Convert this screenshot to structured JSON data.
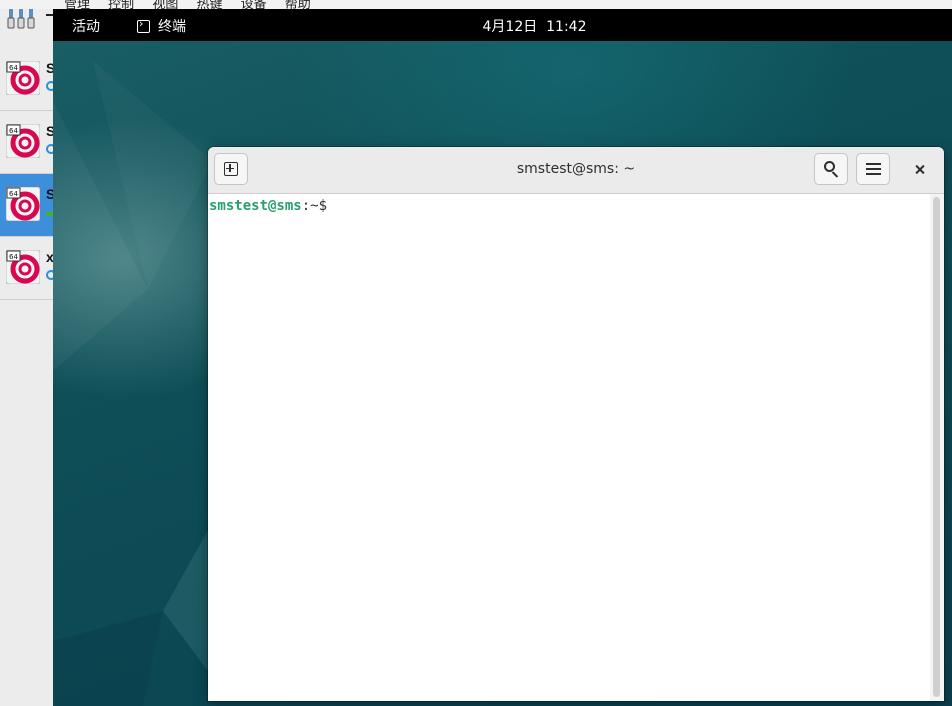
{
  "host": {
    "menu_items": [
      "管理",
      "控制",
      "视图",
      "热键",
      "设备",
      "帮助"
    ],
    "vms": [
      {
        "letter": "S",
        "state": "saved",
        "selected": false
      },
      {
        "letter": "S",
        "state": "saved",
        "selected": false
      },
      {
        "letter": "S",
        "state": "running",
        "selected": true
      },
      {
        "letter": "x",
        "state": "saved",
        "selected": false
      }
    ],
    "vm_badge": "64"
  },
  "guest": {
    "topbar": {
      "activities": "活动",
      "app_name": "终端",
      "clock": "4月12日  11:42"
    },
    "terminal": {
      "title": "smstest@sms: ~",
      "prompt_user": "smstest@sms",
      "prompt_sep": ":",
      "prompt_path": "~$"
    }
  },
  "colors": {
    "prompt_user": "#26a269",
    "selected_row": "#3c8fd8",
    "topbar": "#000000"
  }
}
